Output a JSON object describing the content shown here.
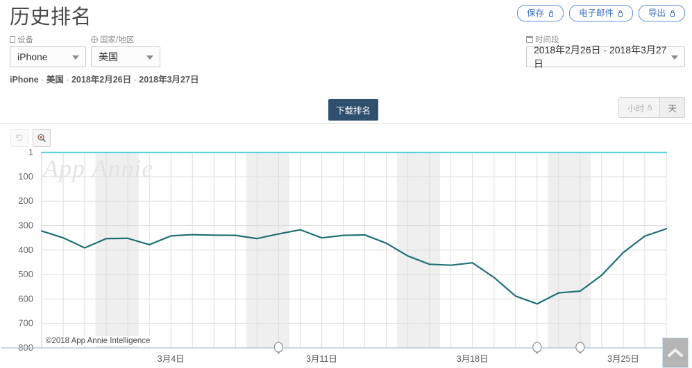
{
  "header": {
    "title": "历史排名",
    "actions": [
      {
        "label": "保存",
        "icon": "lock-icon"
      },
      {
        "label": "电子邮件",
        "icon": "lock-icon"
      },
      {
        "label": "导出",
        "icon": "lock-icon"
      }
    ]
  },
  "filters": {
    "device": {
      "label": "设备",
      "icon": "device-icon",
      "value": "iPhone"
    },
    "country": {
      "label": "国家/地区",
      "icon": "globe-icon",
      "value": "美国"
    },
    "daterange": {
      "label": "时间段",
      "icon": "calendar-icon",
      "value": "2018年2月26日 - 2018年3月27日"
    }
  },
  "breadcrumb": {
    "device": "iPhone",
    "country": "美国",
    "start": "2018年2月26日",
    "end": "2018年3月27日",
    "separator": "-"
  },
  "tabs": {
    "main": "下载排名",
    "granularity": [
      {
        "label": "小时",
        "locked": true,
        "active": false
      },
      {
        "label": "天",
        "locked": false,
        "active": true
      }
    ]
  },
  "chart_toolbar": {
    "reset": {
      "name": "reset-zoom-button",
      "icon": "undo-icon",
      "disabled": true
    },
    "zoom": {
      "name": "zoom-in-button",
      "icon": "magnifier-plus-icon",
      "disabled": false
    }
  },
  "watermark": "App Annie",
  "copyright": "©2018 App Annie Intelligence",
  "scroll_top": {
    "icon": "chevron-up-icon"
  },
  "colors": {
    "accent_blue": "#3a6fc4",
    "tab_dark": "#2f4f6f",
    "line_teal": "#1f6f75",
    "line_cyan": "#5ecfdc",
    "grid": "#dcdcdc",
    "weekend_band": "#efefef"
  },
  "chart_data": {
    "type": "line",
    "title": "",
    "xlabel": "",
    "ylabel": "",
    "ylim": [
      1,
      800
    ],
    "y_inverted": true,
    "grid": true,
    "legend": "none",
    "y_ticks": [
      1,
      100,
      200,
      300,
      400,
      500,
      600,
      700,
      800
    ],
    "x_tick_labels": [
      "3月4日",
      "3月11日",
      "3月18日",
      "3月25日"
    ],
    "x_tick_indices": [
      6,
      13,
      20,
      27
    ],
    "x": [
      "2018-02-26",
      "2018-02-27",
      "2018-02-28",
      "2018-03-01",
      "2018-03-02",
      "2018-03-03",
      "2018-03-04",
      "2018-03-05",
      "2018-03-06",
      "2018-03-07",
      "2018-03-08",
      "2018-03-09",
      "2018-03-10",
      "2018-03-11",
      "2018-03-12",
      "2018-03-13",
      "2018-03-14",
      "2018-03-15",
      "2018-03-16",
      "2018-03-17",
      "2018-03-18",
      "2018-03-19",
      "2018-03-20",
      "2018-03-21",
      "2018-03-22",
      "2018-03-23",
      "2018-03-24",
      "2018-03-25",
      "2018-03-26",
      "2018-03-27"
    ],
    "weekend_indices": [
      [
        3,
        4
      ],
      [
        10,
        11
      ],
      [
        17,
        18
      ],
      [
        24,
        25
      ]
    ],
    "markers": [
      {
        "x_index": 11,
        "icon": "balloon-marker"
      },
      {
        "x_index": 23,
        "icon": "balloon-marker"
      },
      {
        "x_index": 25,
        "icon": "balloon-marker"
      }
    ],
    "series": [
      {
        "name": "下载排名",
        "color": "#1f6f75",
        "values": [
          322,
          350,
          391,
          353,
          352,
          378,
          342,
          337,
          339,
          340,
          353,
          334,
          317,
          350,
          340,
          338,
          372,
          424,
          458,
          462,
          452,
          512,
          588,
          620,
          575,
          568,
          503,
          410,
          343,
          313
        ]
      },
      {
        "name": "top-line",
        "color": "#5ecfdc",
        "values": [
          1,
          1,
          1,
          1,
          1,
          1,
          1,
          1,
          1,
          1,
          1,
          1,
          1,
          1,
          1,
          1,
          1,
          1,
          1,
          1,
          1,
          1,
          1,
          1,
          1,
          1,
          1,
          1,
          1,
          1
        ]
      }
    ]
  }
}
